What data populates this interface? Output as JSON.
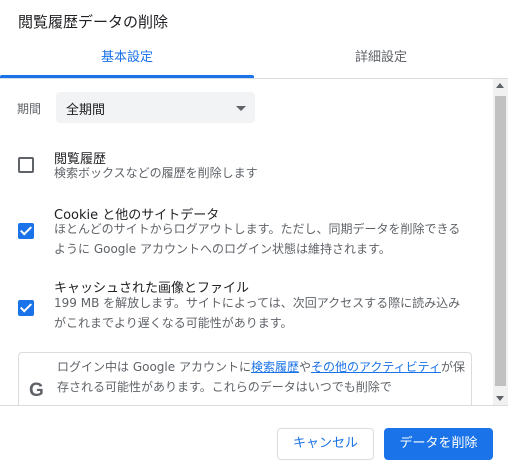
{
  "dialog": {
    "title": "閲覧履歴データの削除"
  },
  "tabs": [
    {
      "label": "基本設定",
      "active": true
    },
    {
      "label": "詳細設定",
      "active": false
    }
  ],
  "period": {
    "label": "期間",
    "value": "全期間"
  },
  "items": [
    {
      "title": "閲覧履歴",
      "description": "検索ボックスなどの履歴を削除します",
      "checked": false
    },
    {
      "title": "Cookie と他のサイトデータ",
      "description": "ほとんどのサイトからログアウトします。ただし、同期データを削除できるように Google アカウントへのログイン状態は維持されます。",
      "checked": true
    },
    {
      "title": "キャッシュされた画像とファイル",
      "description": "199 MB を解放します。サイトによっては、次回アクセスする際に読み込みがこれまでより遅くなる可能性があります。",
      "checked": true
    }
  ],
  "info": {
    "icon": "google-g-icon",
    "text_before": "ログイン中は Google アカウントに",
    "link1": "検索履歴",
    "text_mid": "や",
    "link2": "その他のアクティビティ",
    "text_after": "が保存される可能性があります。これらのデータはいつでも削除で"
  },
  "buttons": {
    "cancel": "キャンセル",
    "delete": "データを削除"
  },
  "colors": {
    "accent": "#1a73e8",
    "text": "#202124",
    "secondary": "#5f6368"
  }
}
